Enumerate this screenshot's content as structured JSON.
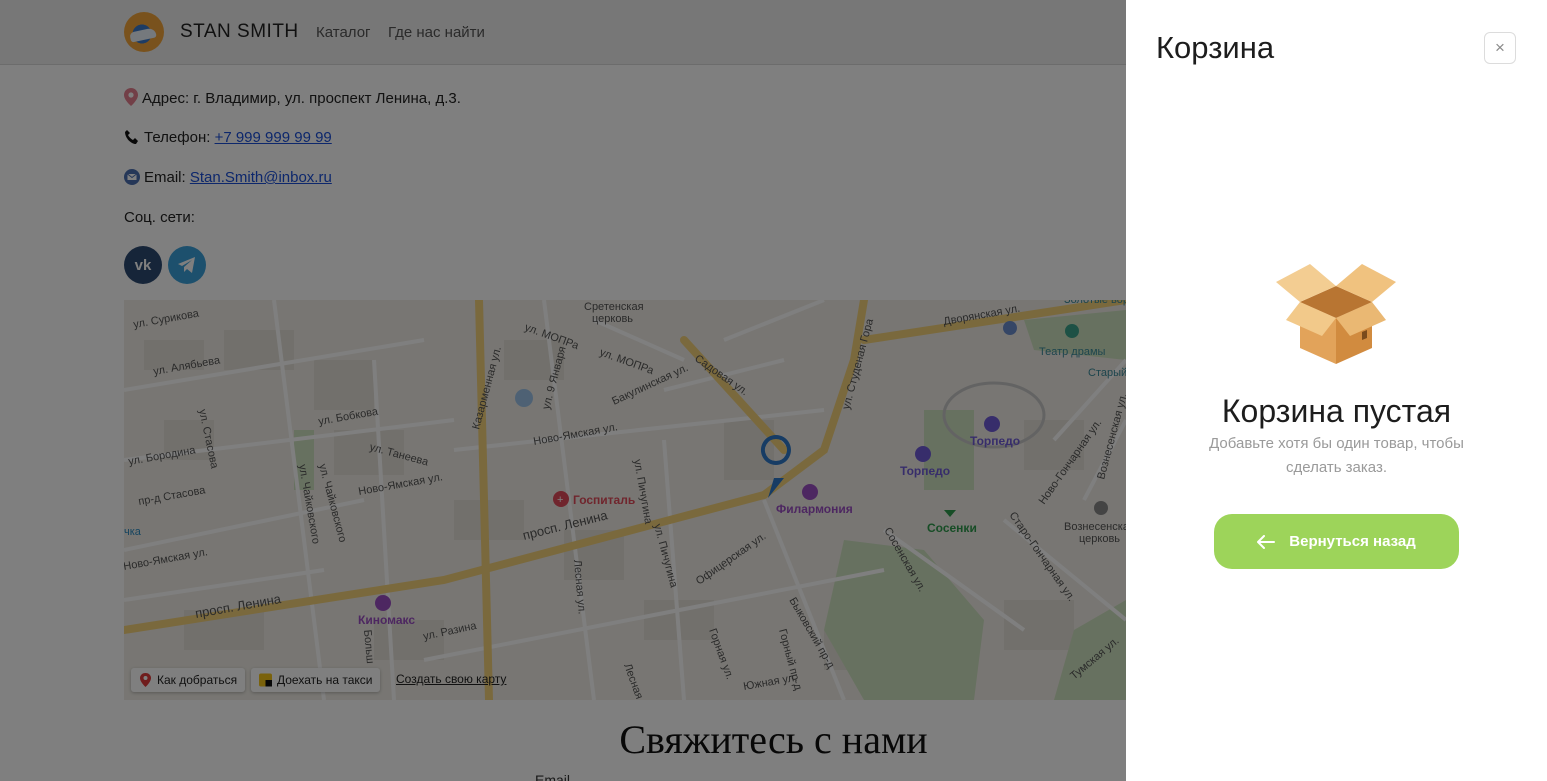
{
  "header": {
    "brand": "STAN SMITH",
    "nav": {
      "catalog": "Каталог",
      "where": "Где нас найти"
    }
  },
  "contacts": {
    "address": "Адрес: г. Владимир, ул. проспект Ленина, д.3.",
    "phone_label": "Телефон: ",
    "phone_value": "+7 999 999 99 99",
    "email_label": "Email: ",
    "email_value": "Stan.Smith@inbox.ru",
    "social_label": "Соц. сети:",
    "social": [
      "vk-icon",
      "telegram-icon"
    ]
  },
  "map": {
    "streets": [
      "ул. Сурикова",
      "ул. Алябьева",
      "ул. Стасова",
      "ул. Бобкова",
      "ул. Танеева",
      "ул. Бородина",
      "пр-д Стасова",
      "ул. Чайковского",
      "Новo-Ямская ул.",
      "Ново-Ямская ул.",
      "Казарменная ул.",
      "ул. МОПРа",
      "ул. 9 Января",
      "Бакулинская ул.",
      "Садовая ул.",
      "ул. Студеная Гора",
      "Дворянская ул.",
      "ул. Пичугина",
      "просп. Ленина",
      "Офицерская ул.",
      "Лесная ул.",
      "ул. Разина",
      "Горная ул.",
      "Быковский пр.д",
      "Горный пр-д",
      "Южная ул.",
      "Лесная ул.",
      "Сосенская ул.",
      "Старо-Гончарная ул.",
      "Ново-Гончарная ул.",
      "Вознесенская ул.",
      "Тумская ул.",
      "ч.ка"
    ],
    "places": [
      "Сретенская церковь",
      "Госпиталь",
      "Филармония",
      "Торпедо",
      "Торпедо",
      "Театр драмы",
      "Старый",
      "Сосенки",
      "Вознесенская церковь",
      "Киномакс",
      "Золотые вор"
    ],
    "route_button": "Как добраться",
    "taxi_button": "Доехать на такси",
    "create_link": "Создать свою карту"
  },
  "contact_section": {
    "title": "Свяжитесь с нами",
    "email_label": "Email"
  },
  "cart": {
    "title": "Корзина",
    "close": "×",
    "empty_title": "Корзина пустая",
    "empty_desc": "Добавьте хотя бы один товар, чтобы сделать заказ.",
    "back_button": "Вернуться назад"
  },
  "colors": {
    "accent_green": "#9dd45a",
    "link_blue": "#1a4fd8",
    "overlay": "rgba(0,0,0,0.5)",
    "road_yellow": "#f5d27a"
  }
}
